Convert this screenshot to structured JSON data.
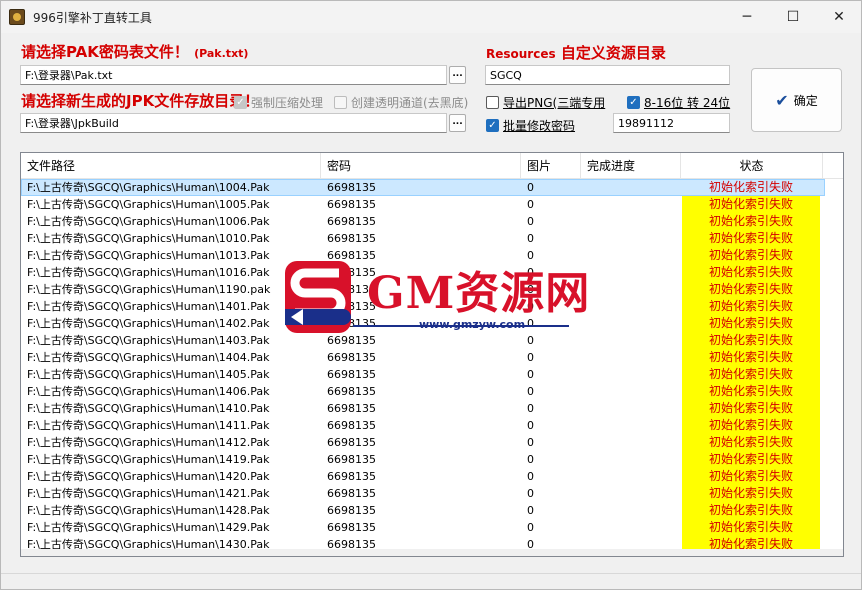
{
  "window": {
    "title": "996引擎补丁直转工具",
    "min_symbol": "─",
    "max_symbol": "☐",
    "close_symbol": "✕"
  },
  "pak": {
    "label_main": "请选择PAK密码表文件！",
    "label_hint": "(Pak.txt)",
    "path": "F:\\登录器\\Pak.txt",
    "browse_label": "..."
  },
  "output": {
    "label": "请选择新生成的JPK文件存放目录！",
    "path": "F:\\登录器\\JpkBuild",
    "browse_label": "..."
  },
  "resources": {
    "label_en": "Resources",
    "label_cn": "自定义资源目录",
    "value": "SGCQ"
  },
  "options": {
    "force_compress": {
      "label": "强制压缩处理",
      "checked": true,
      "disabled": true
    },
    "transparent_channel": {
      "label": "创建透明通道(去黑底)",
      "checked": false,
      "disabled": true
    },
    "export_png": {
      "label": "导出PNG(三端专用",
      "checked": false
    },
    "bit_convert": {
      "label": "8-16位 转 24位",
      "checked": true
    },
    "batch_password": {
      "label": "批量修改密码",
      "checked": true,
      "value": "19891112"
    }
  },
  "ok_button": {
    "icon": "✔",
    "label": "确定"
  },
  "table": {
    "columns": [
      {
        "label": "文件路径"
      },
      {
        "label": "密码"
      },
      {
        "label": "图片"
      },
      {
        "label": "完成进度"
      },
      {
        "label": "状态"
      }
    ],
    "rows": [
      {
        "path": "F:\\上古传奇\\SGCQ\\Graphics\\Human\\1004.Pak",
        "password": "6698135",
        "images": "0",
        "progress": "",
        "status": "初始化索引失败",
        "selected": true
      },
      {
        "path": "F:\\上古传奇\\SGCQ\\Graphics\\Human\\1005.Pak",
        "password": "6698135",
        "images": "0",
        "progress": "",
        "status": "初始化索引失败"
      },
      {
        "path": "F:\\上古传奇\\SGCQ\\Graphics\\Human\\1006.Pak",
        "password": "6698135",
        "images": "0",
        "progress": "",
        "status": "初始化索引失败"
      },
      {
        "path": "F:\\上古传奇\\SGCQ\\Graphics\\Human\\1010.Pak",
        "password": "6698135",
        "images": "0",
        "progress": "",
        "status": "初始化索引失败"
      },
      {
        "path": "F:\\上古传奇\\SGCQ\\Graphics\\Human\\1013.Pak",
        "password": "6698135",
        "images": "0",
        "progress": "",
        "status": "初始化索引失败"
      },
      {
        "path": "F:\\上古传奇\\SGCQ\\Graphics\\Human\\1016.Pak",
        "password": "6698135",
        "images": "0",
        "progress": "",
        "status": "初始化索引失败"
      },
      {
        "path": "F:\\上古传奇\\SGCQ\\Graphics\\Human\\1190.pak",
        "password": "6698135",
        "images": "0",
        "progress": "",
        "status": "初始化索引失败"
      },
      {
        "path": "F:\\上古传奇\\SGCQ\\Graphics\\Human\\1401.Pak",
        "password": "6698135",
        "images": "0",
        "progress": "",
        "status": "初始化索引失败"
      },
      {
        "path": "F:\\上古传奇\\SGCQ\\Graphics\\Human\\1402.Pak",
        "password": "6698135",
        "images": "0",
        "progress": "",
        "status": "初始化索引失败"
      },
      {
        "path": "F:\\上古传奇\\SGCQ\\Graphics\\Human\\1403.Pak",
        "password": "6698135",
        "images": "0",
        "progress": "",
        "status": "初始化索引失败"
      },
      {
        "path": "F:\\上古传奇\\SGCQ\\Graphics\\Human\\1404.Pak",
        "password": "6698135",
        "images": "0",
        "progress": "",
        "status": "初始化索引失败"
      },
      {
        "path": "F:\\上古传奇\\SGCQ\\Graphics\\Human\\1405.Pak",
        "password": "6698135",
        "images": "0",
        "progress": "",
        "status": "初始化索引失败"
      },
      {
        "path": "F:\\上古传奇\\SGCQ\\Graphics\\Human\\1406.Pak",
        "password": "6698135",
        "images": "0",
        "progress": "",
        "status": "初始化索引失败"
      },
      {
        "path": "F:\\上古传奇\\SGCQ\\Graphics\\Human\\1410.Pak",
        "password": "6698135",
        "images": "0",
        "progress": "",
        "status": "初始化索引失败"
      },
      {
        "path": "F:\\上古传奇\\SGCQ\\Graphics\\Human\\1411.Pak",
        "password": "6698135",
        "images": "0",
        "progress": "",
        "status": "初始化索引失败"
      },
      {
        "path": "F:\\上古传奇\\SGCQ\\Graphics\\Human\\1412.Pak",
        "password": "6698135",
        "images": "0",
        "progress": "",
        "status": "初始化索引失败"
      },
      {
        "path": "F:\\上古传奇\\SGCQ\\Graphics\\Human\\1419.Pak",
        "password": "6698135",
        "images": "0",
        "progress": "",
        "status": "初始化索引失败"
      },
      {
        "path": "F:\\上古传奇\\SGCQ\\Graphics\\Human\\1420.Pak",
        "password": "6698135",
        "images": "0",
        "progress": "",
        "status": "初始化索引失败"
      },
      {
        "path": "F:\\上古传奇\\SGCQ\\Graphics\\Human\\1421.Pak",
        "password": "6698135",
        "images": "0",
        "progress": "",
        "status": "初始化索引失败"
      },
      {
        "path": "F:\\上古传奇\\SGCQ\\Graphics\\Human\\1428.Pak",
        "password": "6698135",
        "images": "0",
        "progress": "",
        "status": "初始化索引失败"
      },
      {
        "path": "F:\\上古传奇\\SGCQ\\Graphics\\Human\\1429.Pak",
        "password": "6698135",
        "images": "0",
        "progress": "",
        "status": "初始化索引失败"
      },
      {
        "path": "F:\\上古传奇\\SGCQ\\Graphics\\Human\\1430.Pak",
        "password": "6698135",
        "images": "0",
        "progress": "",
        "status": "初始化索引失败"
      }
    ]
  },
  "watermark": {
    "text": "GM资源网",
    "url": "www.gmzyw.com"
  },
  "colors": {
    "label_red": "#d40000",
    "status_fill": "#ffff00",
    "selection": "#cce8ff",
    "watermark_red": "#d8112a",
    "watermark_blue": "#1a2f8a"
  }
}
